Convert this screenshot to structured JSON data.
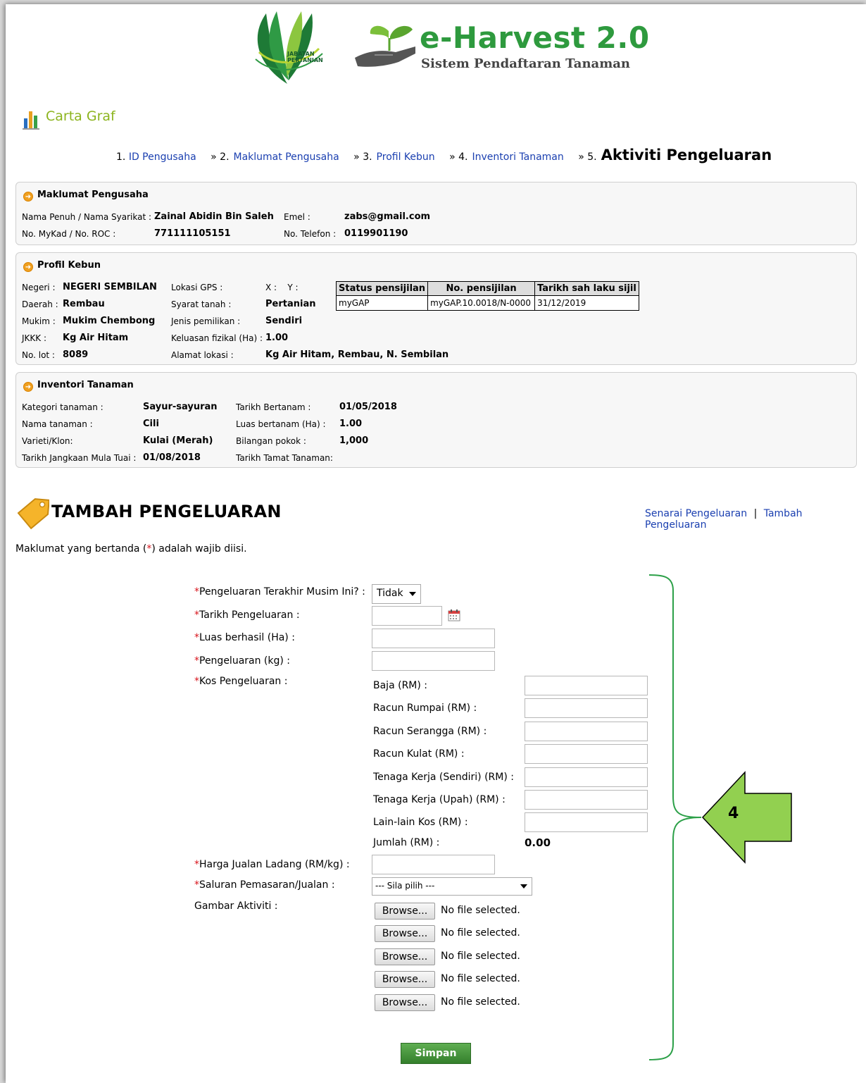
{
  "header": {
    "dept_logo_lines": [
      "JABATAN",
      "PERTANIAN"
    ],
    "app_title": "e-Harvest 2.0",
    "app_subtitle": "Sistem Pendaftaran Tanaman"
  },
  "carta": {
    "title": "Carta Graf",
    "icon": "bar-chart-icon"
  },
  "steps": [
    {
      "num": "1.",
      "label": "ID Pengusaha"
    },
    {
      "num": "» 2.",
      "label": "Maklumat Pengusaha"
    },
    {
      "num": "» 3.",
      "label": "Profil Kebun"
    },
    {
      "num": "» 4.",
      "label": "Inventori Tanaman"
    },
    {
      "num": "» 5.",
      "label": "Aktiviti Pengeluaran"
    }
  ],
  "pengusaha": {
    "title": "Maklumat Pengusaha",
    "nama_label": "Nama Penuh / Nama Syarikat :",
    "nama": "Zainal Abidin Bin Saleh",
    "mykad_label": "No. MyKad / No. ROC :",
    "mykad": "771111105151",
    "emel_label": "Emel :",
    "emel": "zabs@gmail.com",
    "telefon_label": "No. Telefon :",
    "telefon": "0119901190"
  },
  "kebun": {
    "title": "Profil Kebun",
    "negeri_label": "Negeri :",
    "negeri": "NEGERI SEMBILAN",
    "daerah_label": "Daerah :",
    "daerah": "Rembau",
    "mukim_label": "Mukim :",
    "mukim": "Mukim Chembong",
    "jkkk_label": "JKKK :",
    "jkkk": "Kg Air Hitam",
    "lot_label": "No. lot :",
    "lot": "8089",
    "gps_label": "Lokasi GPS :",
    "gps_xy": "X :    Y :",
    "syarat_label": "Syarat tanah :",
    "syarat": "Pertanian",
    "pemilikan_label": "Jenis pemilikan :",
    "pemilikan": "Sendiri",
    "keluasan_label": "Keluasan fizikal (Ha) :",
    "keluasan": "1.00",
    "alamat_label": "Alamat lokasi :",
    "alamat": "Kg Air Hitam, Rembau, N. Sembilan",
    "cert_headers": [
      "Status pensijilan",
      "No. pensijilan",
      "Tarikh sah laku sijil"
    ],
    "cert_row": [
      "myGAP",
      "myGAP.10.0018/N-0000",
      "31/12/2019"
    ]
  },
  "inventori": {
    "title": "Inventori Tanaman",
    "kategori_label": "Kategori tanaman :",
    "kategori": "Sayur-sayuran",
    "nama_label": "Nama tanaman :",
    "nama": "Cili",
    "varieti_label": "Varieti/Klon:",
    "varieti": "Kulai (Merah)",
    "jangkaan_label": "Tarikh Jangkaan Mula Tuai :",
    "jangkaan": "01/08/2018",
    "bertanam_label": "Tarikh Bertanam :",
    "bertanam": "01/05/2018",
    "luas_label": "Luas bertanam (Ha) :",
    "luas": "1.00",
    "pokok_label": "Bilangan pokok :",
    "pokok": "1,000",
    "tamat_label": "Tarikh Tamat Tanaman:"
  },
  "tambah": {
    "title": "TAMBAH PENGELUARAN",
    "link_senarai": "Senarai Pengeluaran",
    "link_sep": "|",
    "link_tambah": "Tambah Pengeluaran",
    "note_before": "Maklumat yang bertanda (",
    "note_star": "*",
    "note_after": ") adalah wajib diisi."
  },
  "form": {
    "star": "*",
    "terakhir_label": "Pengeluaran Terakhir Musim Ini? :",
    "terakhir_value": "Tidak",
    "tarikh_label": "Tarikh Pengeluaran :",
    "luas_label": "Luas berhasil (Ha) :",
    "pengeluaran_label": "Pengeluaran (kg) :",
    "kos_label": "Kos Pengeluaran :",
    "kos_items": [
      "Baja (RM) :",
      "Racun Rumpai (RM) :",
      "Racun Serangga (RM) :",
      "Racun Kulat (RM) :",
      "Tenaga Kerja (Sendiri) (RM) :",
      "Tenaga Kerja (Upah) (RM) :",
      "Lain-lain Kos (RM) :"
    ],
    "jumlah_label": "Jumlah (RM) :",
    "jumlah_value": "0.00",
    "harga_label": "Harga Jualan Ladang (RM/kg) :",
    "saluran_label": "Saluran Pemasaran/Jualan :",
    "saluran_value": "--- Sila pilih ---",
    "gambar_label": "Gambar Aktiviti :",
    "browse_label": "Browse...",
    "no_file": "No file selected.",
    "submit": "Simpan"
  },
  "callout": {
    "number": "4",
    "color": "#92d050"
  }
}
